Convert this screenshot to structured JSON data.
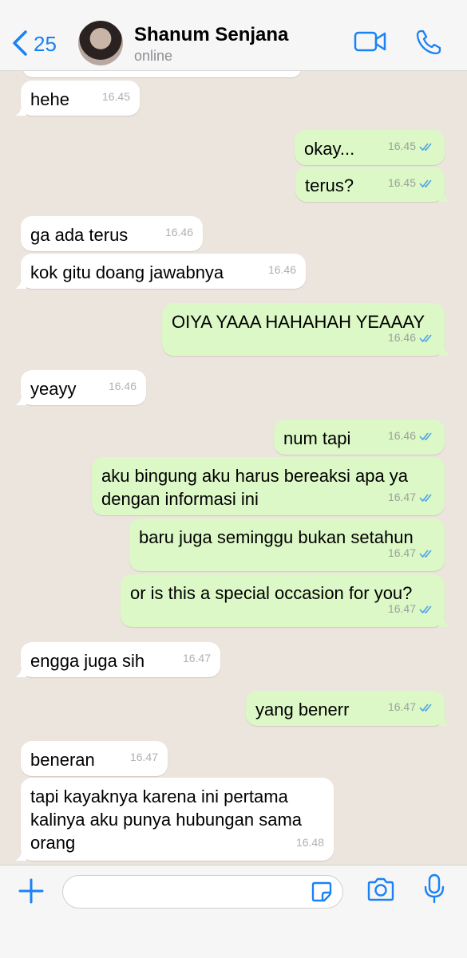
{
  "header": {
    "back_count": "25",
    "contact_name": "Shanum Senjana",
    "status": "online"
  },
  "messages": [
    {
      "dir": "in",
      "text": "hehe",
      "time": "16.45"
    },
    {
      "dir": "out",
      "text": "okay...",
      "time": "16.45",
      "read": true
    },
    {
      "dir": "out",
      "text": "terus?",
      "time": "16.45",
      "read": true
    },
    {
      "dir": "in",
      "text": "ga ada terus",
      "time": "16.46"
    },
    {
      "dir": "in",
      "text": "kok gitu doang jawabnya",
      "time": "16.46"
    },
    {
      "dir": "out",
      "text": "OIYA YAAA HAHAHAH YEAAAY",
      "time": "16.46",
      "read": true
    },
    {
      "dir": "in",
      "text": "yeayy",
      "time": "16.46"
    },
    {
      "dir": "out",
      "text": "num tapi",
      "time": "16.46",
      "read": true
    },
    {
      "dir": "out",
      "text": "aku bingung aku harus bereaksi apa ya dengan informasi ini",
      "time": "16.47",
      "read": true
    },
    {
      "dir": "out",
      "text": "baru juga seminggu bukan setahun",
      "time": "16.47",
      "read": true
    },
    {
      "dir": "out",
      "text": "or is this a special occasion for you?",
      "time": "16.47",
      "read": true
    },
    {
      "dir": "in",
      "text": "engga juga sih",
      "time": "16.47"
    },
    {
      "dir": "out",
      "text": "yang benerr",
      "time": "16.47",
      "read": true
    },
    {
      "dir": "in",
      "text": "beneran",
      "time": "16.47"
    },
    {
      "dir": "in",
      "text": "tapi kayaknya karena ini pertama kalinya aku punya hubungan sama orang",
      "time": "16.48"
    }
  ],
  "colors": {
    "accent": "#1a82f5",
    "incoming_bubble": "#ffffff",
    "outgoing_bubble": "#dcf8c6",
    "chat_background": "#ece5dd",
    "read_tick": "#4fa3e8"
  },
  "icons": {
    "back": "chevron-left-icon",
    "video": "video-camera-icon",
    "call": "phone-icon",
    "add": "plus-icon",
    "sticker": "sticker-icon",
    "camera": "camera-icon",
    "mic": "microphone-icon"
  }
}
